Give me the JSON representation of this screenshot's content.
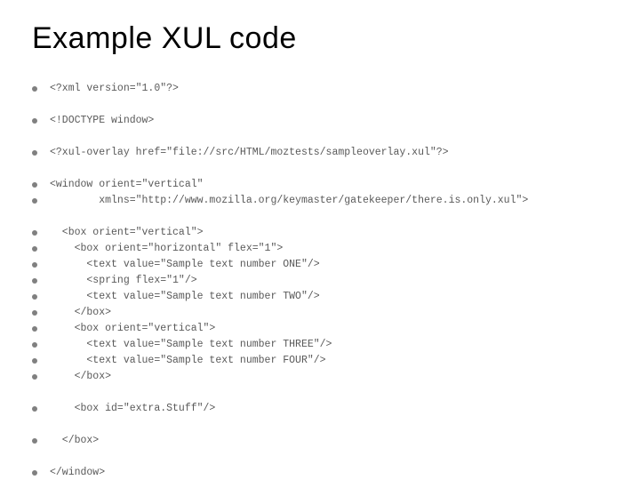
{
  "title": "Example XUL code",
  "lines": [
    {
      "text": "<?xml version=\"1.0\"?>",
      "indent": 0
    },
    null,
    {
      "text": "<!DOCTYPE window>",
      "indent": 0
    },
    null,
    {
      "text": "<?xul-overlay href=\"file://src/HTML/moztests/sampleoverlay.xul\"?>",
      "indent": 0
    },
    null,
    {
      "text": "<window orient=\"vertical\"",
      "indent": 0
    },
    {
      "text": "        xmlns=\"http://www.mozilla.org/keymaster/gatekeeper/there.is.only.xul\">",
      "indent": 0
    },
    null,
    {
      "text": "  <box orient=\"vertical\">",
      "indent": 0
    },
    {
      "text": "    <box orient=\"horizontal\" flex=\"1\">",
      "indent": 0
    },
    {
      "text": "      <text value=\"Sample text number ONE\"/>",
      "indent": 0
    },
    {
      "text": "      <spring flex=\"1\"/>",
      "indent": 0
    },
    {
      "text": "      <text value=\"Sample text number TWO\"/>",
      "indent": 0
    },
    {
      "text": "    </box>",
      "indent": 0
    },
    {
      "text": "    <box orient=\"vertical\">",
      "indent": 0
    },
    {
      "text": "      <text value=\"Sample text number THREE\"/>",
      "indent": 0
    },
    {
      "text": "      <text value=\"Sample text number FOUR\"/>",
      "indent": 0
    },
    {
      "text": "    </box>",
      "indent": 0
    },
    null,
    {
      "text": "    <box id=\"extra.Stuff\"/>",
      "indent": 0
    },
    null,
    {
      "text": "  </box>",
      "indent": 0
    },
    null,
    {
      "text": "</window>",
      "indent": 0
    }
  ]
}
